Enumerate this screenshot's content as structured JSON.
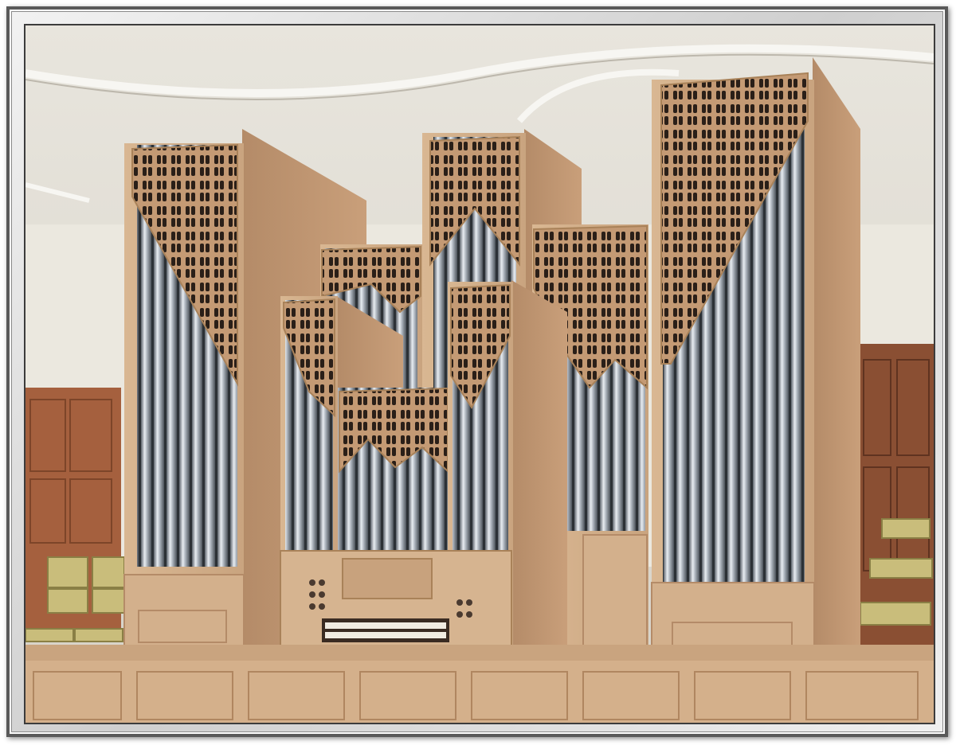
{
  "image": {
    "subject": "pipe-organ",
    "colors": {
      "wood": "#d3b08c",
      "wood_dark": "#b48b68",
      "wood_shadow": "#8f6a4c",
      "pipe_light": "#e9edf2",
      "pipe_mid": "#a9b1ba",
      "pipe_dark": "#5d646c",
      "ceiling": "#e4e1d9",
      "wall": "#ece9e1",
      "paneling": "#a5603e",
      "chair": "#c9bd7b",
      "frame": "#dcdcdc"
    }
  }
}
